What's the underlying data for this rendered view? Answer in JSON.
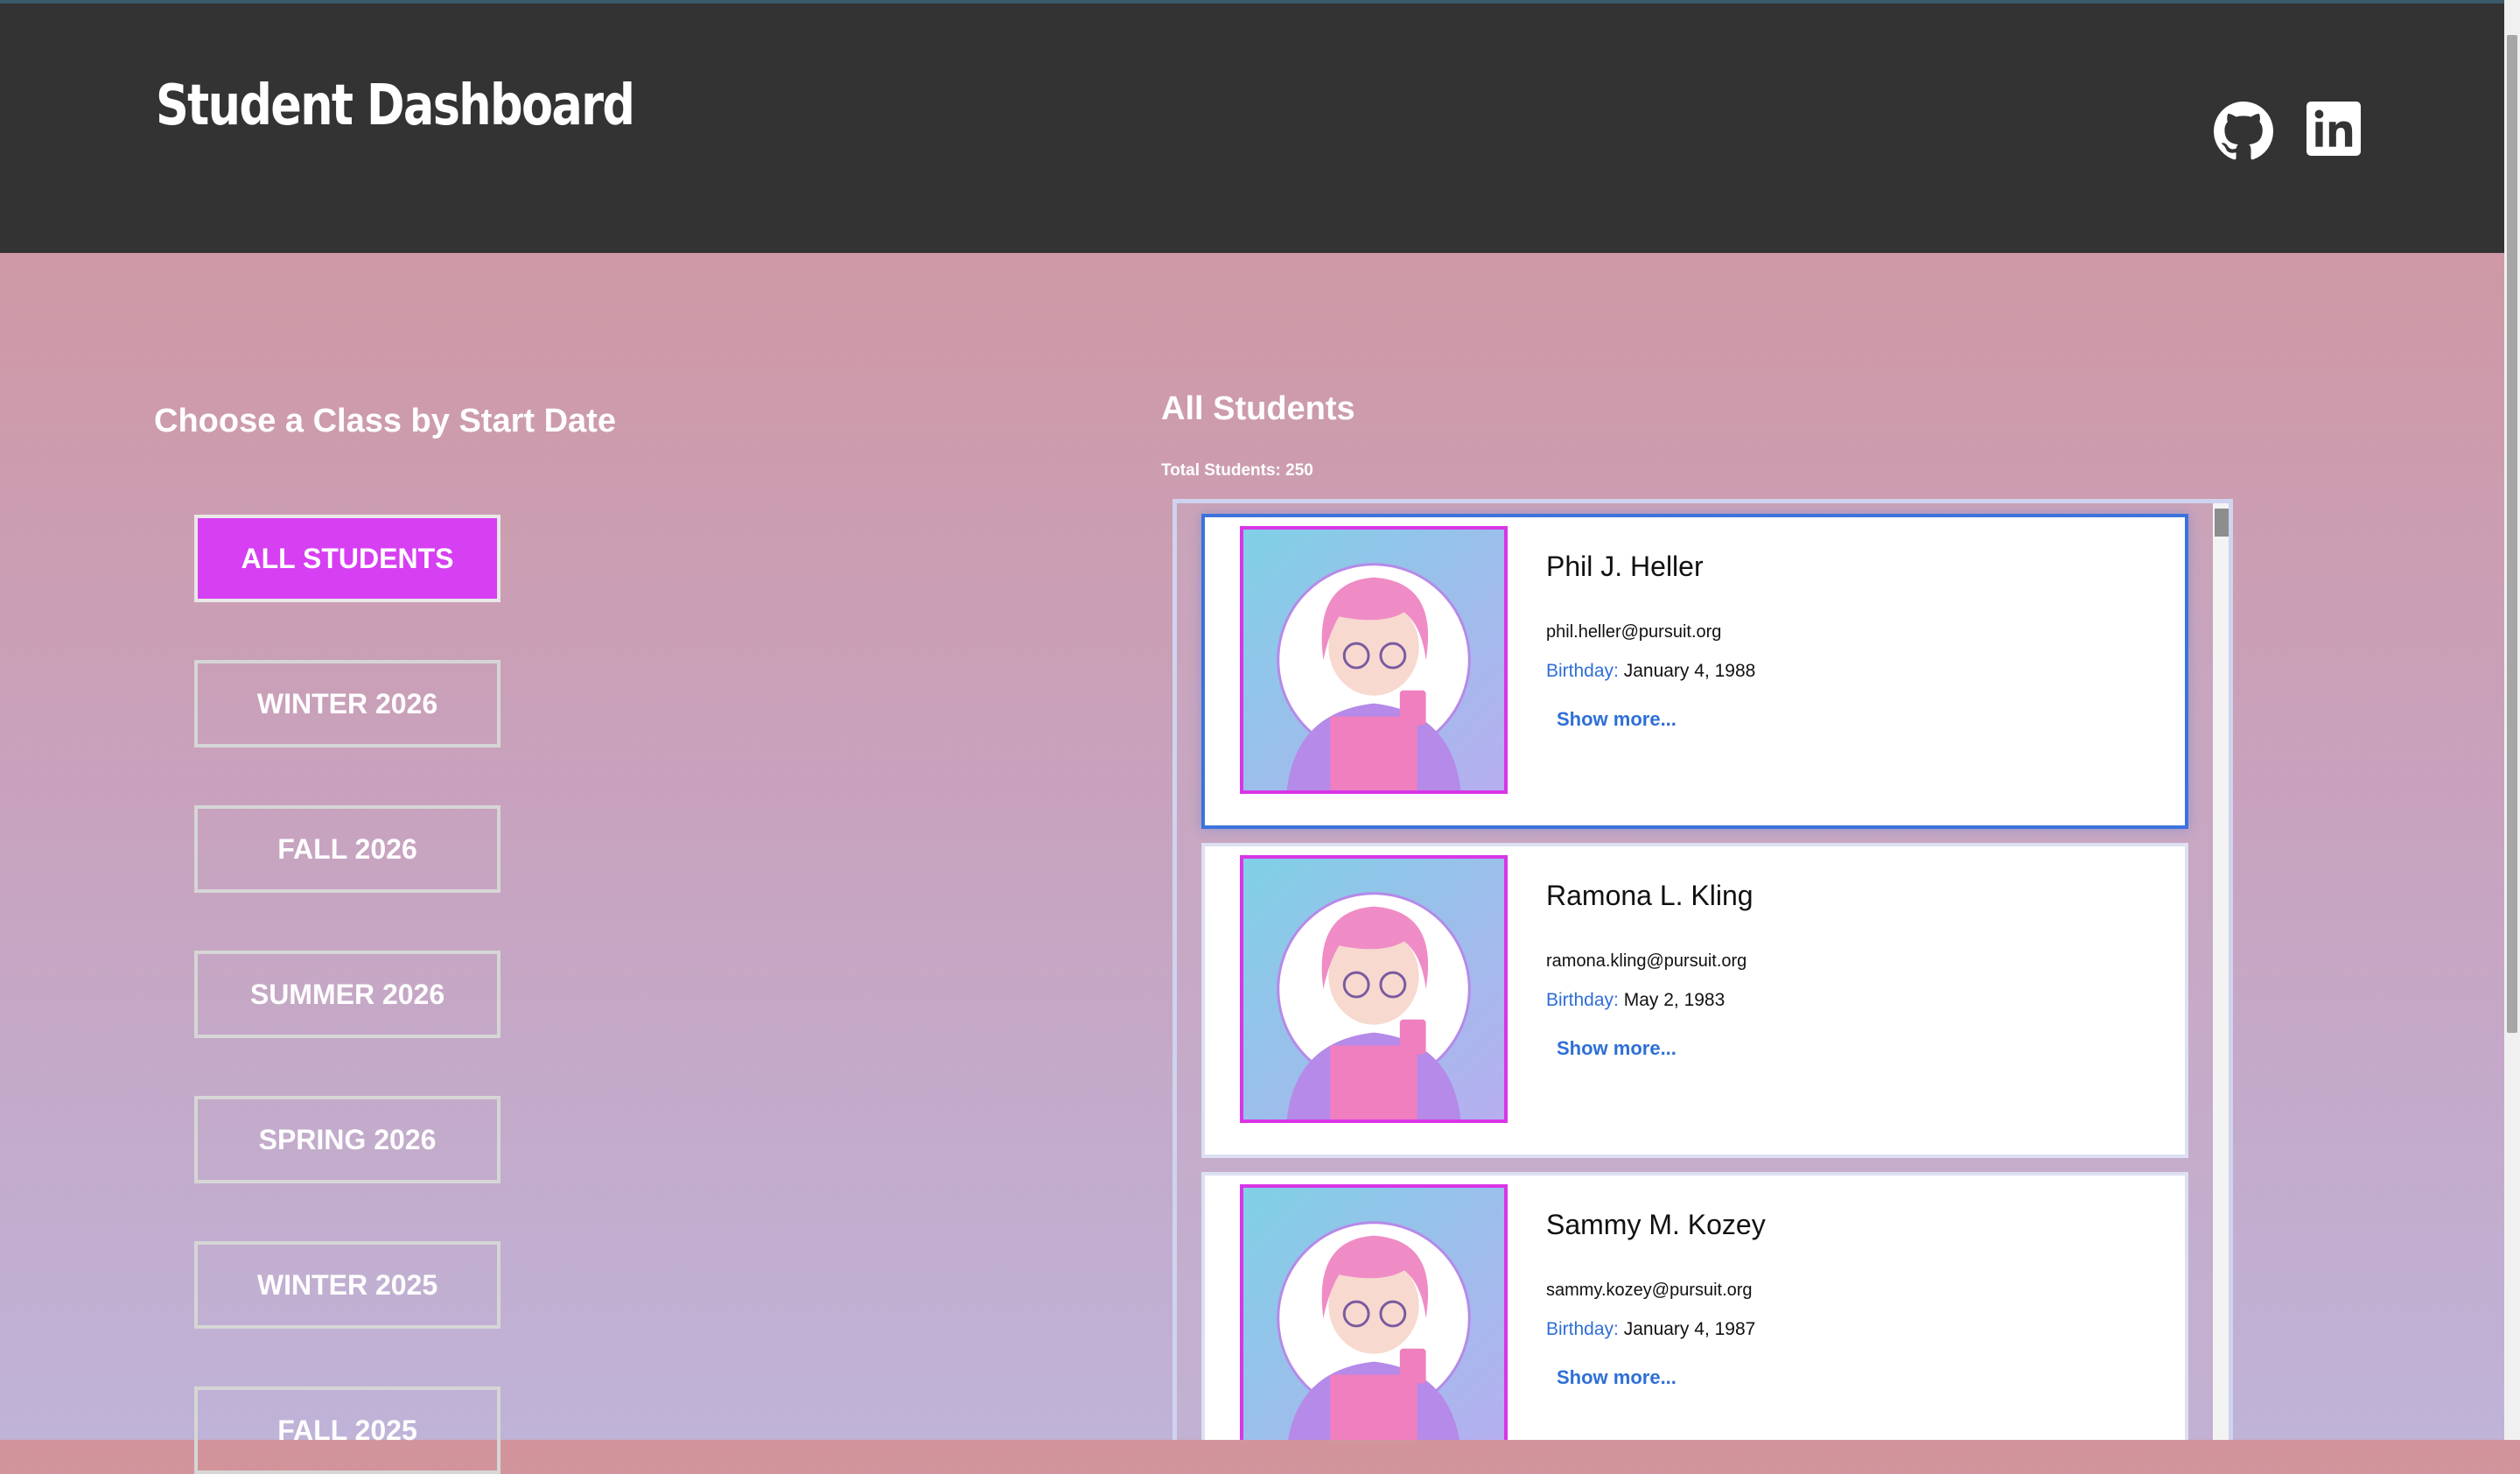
{
  "header": {
    "title": "Student Dashboard",
    "icons": [
      "github-icon",
      "linkedin-icon"
    ]
  },
  "left": {
    "heading": "Choose a Class by Start Date",
    "buttons": [
      "ALL STUDENTS",
      "WINTER 2026",
      "FALL 2026",
      "SUMMER 2026",
      "SPRING 2026",
      "WINTER 2025",
      "FALL 2025"
    ],
    "active_button": "ALL STUDENTS"
  },
  "right": {
    "heading": "All Students",
    "total": "Total Students: 250",
    "birthday_label": "Birthday:",
    "show_more": "Show more...",
    "students": [
      {
        "name": "Phil J. Heller",
        "email": "phil.heller@pursuit.org",
        "birthday": "January 4, 1988"
      },
      {
        "name": "Ramona L. Kling",
        "email": "ramona.kling@pursuit.org",
        "birthday": "May 2, 1983"
      },
      {
        "name": "Sammy M. Kozey",
        "email": "sammy.kozey@pursuit.org",
        "birthday": "January 4, 1987"
      }
    ]
  },
  "colors": {
    "header_bg": "#333333",
    "active_button": "#d63ff2",
    "link_blue": "#2e6fd6",
    "avatar_border": "#d935e6"
  }
}
